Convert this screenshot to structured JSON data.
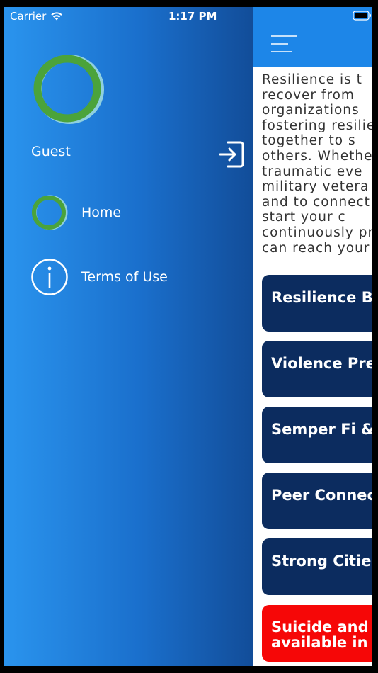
{
  "status_bar": {
    "carrier": "Carrier",
    "time": "1:17 PM",
    "wifi_icon": "wifi-icon",
    "battery_icon": "battery-icon"
  },
  "drawer": {
    "user_name": "Guest",
    "logo_icon": "ring-logo-icon",
    "login_icon": "sign-in-icon",
    "menu": [
      {
        "label": "Home",
        "icon": "ring-logo-icon"
      },
      {
        "label": "Terms of Use",
        "icon": "info-icon"
      }
    ]
  },
  "main": {
    "menu_icon": "hamburger-icon",
    "intro_lines": [
      "Resilience is t",
      "recover from",
      "organizations",
      "fostering resilie",
      "together to s",
      "others. Whethe",
      "traumatic eve",
      "military vetera",
      "and to connect",
      "start your c",
      "continuously pr",
      "can reach your"
    ],
    "cards": [
      "Resilience Bu",
      "Violence Pre",
      "Semper Fi &",
      "Peer Connec",
      "Strong Cities",
      "Suicide and available in"
    ]
  },
  "colors": {
    "drawer_gradient_start": "#2a94ee",
    "drawer_gradient_end": "#124d99",
    "nav_bar": "#1d86e8",
    "card": "#0c2c5f",
    "alert_card": "#f60707",
    "logo_green": "#4ba33b"
  }
}
